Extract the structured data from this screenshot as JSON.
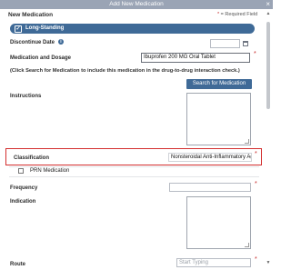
{
  "window": {
    "title": "Add New Medication",
    "close_glyph": "×"
  },
  "header": {
    "section_title": "New Medication",
    "required_note_star": "*",
    "required_note": "= Required Field"
  },
  "long_standing": {
    "label": "Long-Standing",
    "checked": true,
    "check_glyph": "✓"
  },
  "fields": {
    "discontinue_date": {
      "label": "Discontinue Date",
      "value": ""
    },
    "medication_dosage": {
      "label": "Medication and Dosage",
      "value": "Ibuprofen 200 MG Oral Tablet"
    },
    "search_hint": "(Click Search for Medication to include this medication in the drug-to-drug interaction check.)",
    "search_button": "Search for Medication",
    "instructions": {
      "label": "Instructions",
      "value": ""
    },
    "classification": {
      "label": "Classification",
      "value": "Nonsteroidal Anti-Inflammatory Ag"
    },
    "prn": {
      "label": "PRN Medication",
      "checked": false
    },
    "frequency": {
      "label": "Frequency",
      "value": ""
    },
    "indication": {
      "label": "Indication",
      "value": ""
    },
    "route": {
      "label": "Route",
      "placeholder": "Start Typing"
    }
  },
  "required_star": "*",
  "info_glyph": "i",
  "icons": [
    "info-icon",
    "calendar-icon",
    "check-icon",
    "close-icon"
  ],
  "colors": {
    "accent": "#3f6a97",
    "titlebar": "#9aa4b5",
    "highlight": "#d32f2f",
    "required": "#c62828"
  }
}
